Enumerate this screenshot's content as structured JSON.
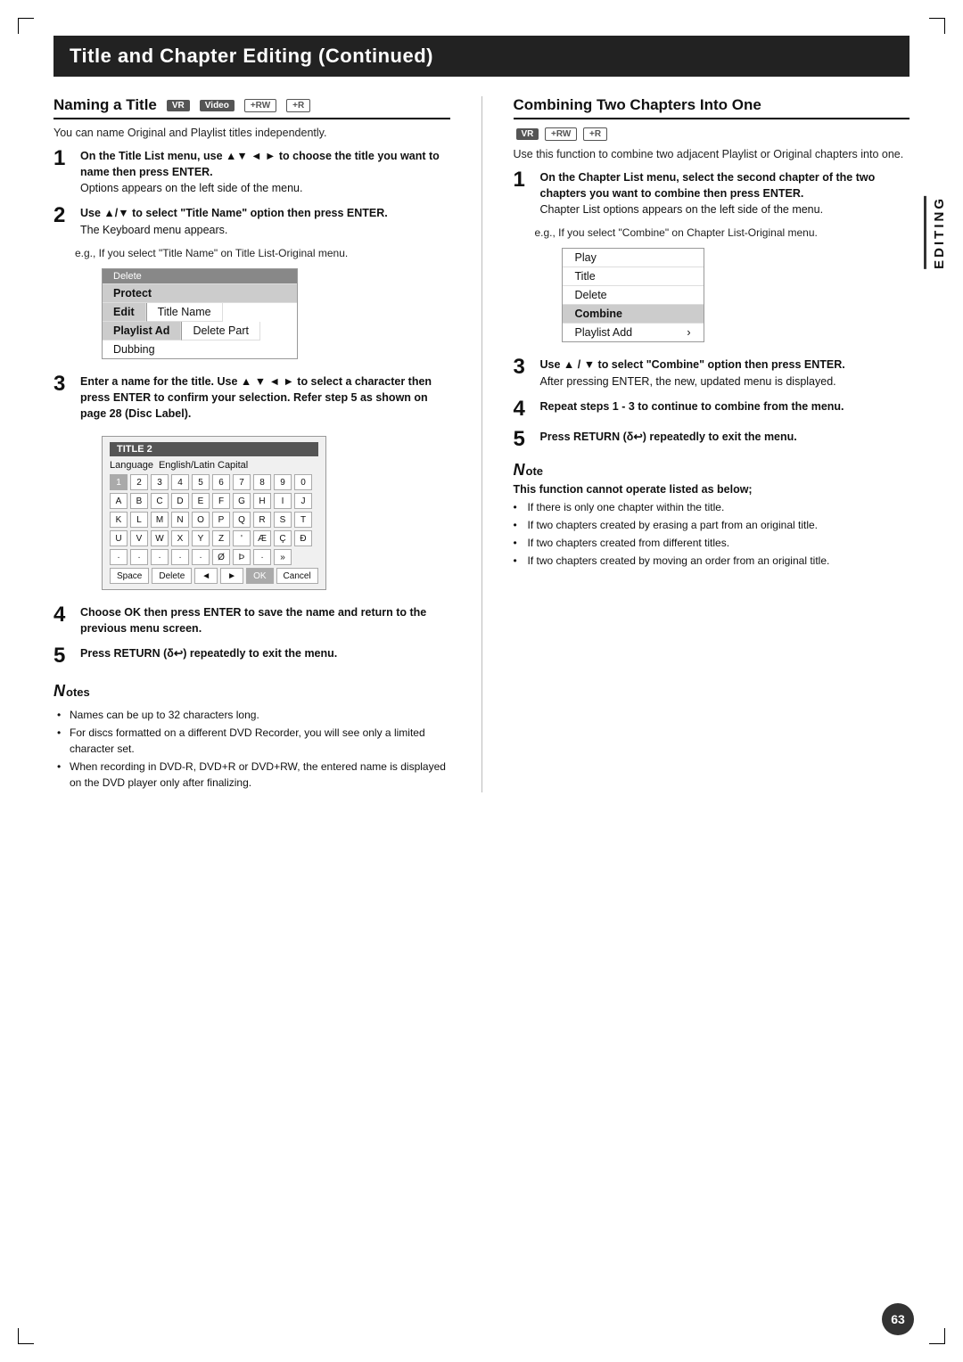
{
  "page": {
    "title": "Title and Chapter Editing (Continued)",
    "page_number": "63",
    "editing_sidebar": "EDITING"
  },
  "left_section": {
    "header": "Naming a Title",
    "badges": [
      "VR",
      "Video",
      "+RW",
      "+R"
    ],
    "intro": "You can name Original and Playlist titles independently.",
    "steps": [
      {
        "num": "1",
        "text": "On the Title List menu, use ▲▼ ◄ ► to choose the title you want to name then press ENTER.",
        "sub": "Options appears on the left side of the menu."
      },
      {
        "num": "2",
        "text": "Use ▲/▼ to select \"Title Name\" option then press ENTER.",
        "sub": "The Keyboard menu appears."
      },
      {
        "num": "",
        "text": "e.g., If you select \"Title Name\" on Title List-Original menu."
      },
      {
        "num": "3",
        "text": "Enter a name for the title. Use ▲ ▼ ◄ ► to select a character then press ENTER to confirm your selection. Refer step 5 as shown on page 28 (Disc Label)."
      },
      {
        "num": "4",
        "text": "Choose OK then press ENTER to save the name and return to the previous menu screen."
      },
      {
        "num": "5",
        "text": "Press RETURN (δ↩) repeatedly to exit the menu."
      }
    ],
    "menu": {
      "items": [
        {
          "label": "Delete",
          "type": "dark-top"
        },
        {
          "label": "Protect",
          "type": "normal"
        },
        {
          "label": "Edit",
          "type": "highlighted-row",
          "sub": "Title Name"
        },
        {
          "label": "Playlist Ad",
          "type": "highlighted-row2",
          "sub": "Delete Part"
        },
        {
          "label": "Dubbing",
          "type": "normal"
        }
      ]
    },
    "keyboard": {
      "title": "TITLE 2",
      "lang_label": "Language",
      "lang_value": "English/Latin Capital",
      "rows": [
        [
          "1",
          "2",
          "3",
          "4",
          "5",
          "6",
          "7",
          "8",
          "9",
          "0"
        ],
        [
          "A",
          "B",
          "C",
          "D",
          "E",
          "F",
          "G",
          "H",
          "I",
          "J"
        ],
        [
          "K",
          "L",
          "M",
          "N",
          "O",
          "P",
          "Q",
          "R",
          "S",
          "T"
        ],
        [
          "U",
          "V",
          "W",
          "X",
          "Y",
          "Z",
          "'",
          "Æ",
          "C",
          "Ð"
        ]
      ],
      "special_row": [
        "·",
        "·",
        "·",
        "·",
        "·",
        "Ø",
        "Þ",
        "·",
        "»"
      ],
      "bottom_keys": [
        "Space",
        "Delete",
        "◄",
        "►",
        "OK",
        "Cancel"
      ]
    },
    "notes": {
      "header": "Notes",
      "items": [
        "Names can be up to 32 characters long.",
        "For discs formatted on a different DVD Recorder, you will see only a limited character set.",
        "When recording in DVD-R, DVD+R or DVD+RW, the entered name is displayed on the DVD player only after finalizing."
      ]
    }
  },
  "right_section": {
    "header": "Combining Two Chapters Into One",
    "badges": [
      "VR",
      "+RW",
      "+R"
    ],
    "intro": "Use this function to combine two adjacent Playlist or Original chapters into one.",
    "steps": [
      {
        "num": "1",
        "text": "On the Chapter List menu, select the second chapter of the two chapters you want to combine then press ENTER.",
        "sub": "Chapter List options appears on the left side of the menu."
      },
      {
        "num": "",
        "text": "e.g., If you select \"Combine\" on Chapter List-Original menu."
      },
      {
        "num": "3",
        "text": "Use ▲ / ▼ to select \"Combine\" option then press ENTER.",
        "sub": "After pressing ENTER, the new, updated menu is displayed."
      },
      {
        "num": "4",
        "text": "Repeat steps 1 - 3 to continue to combine from the menu."
      },
      {
        "num": "5",
        "text": "Press RETURN (δ↩) repeatedly to exit the menu."
      }
    ],
    "menu": {
      "items": [
        {
          "label": "Play",
          "type": "normal"
        },
        {
          "label": "Title",
          "type": "normal"
        },
        {
          "label": "Delete",
          "type": "normal"
        },
        {
          "label": "Combine",
          "type": "highlighted"
        },
        {
          "label": "Playlist Add",
          "type": "arrow"
        }
      ]
    },
    "note": {
      "header": "Note",
      "this_function": "This function cannot operate listed as below;",
      "items": [
        "If there is only one chapter within the title.",
        "If two chapters created by erasing a part from an original title.",
        "If two chapters created from different titles.",
        "If two chapters created by moving an order from an original title."
      ]
    }
  }
}
